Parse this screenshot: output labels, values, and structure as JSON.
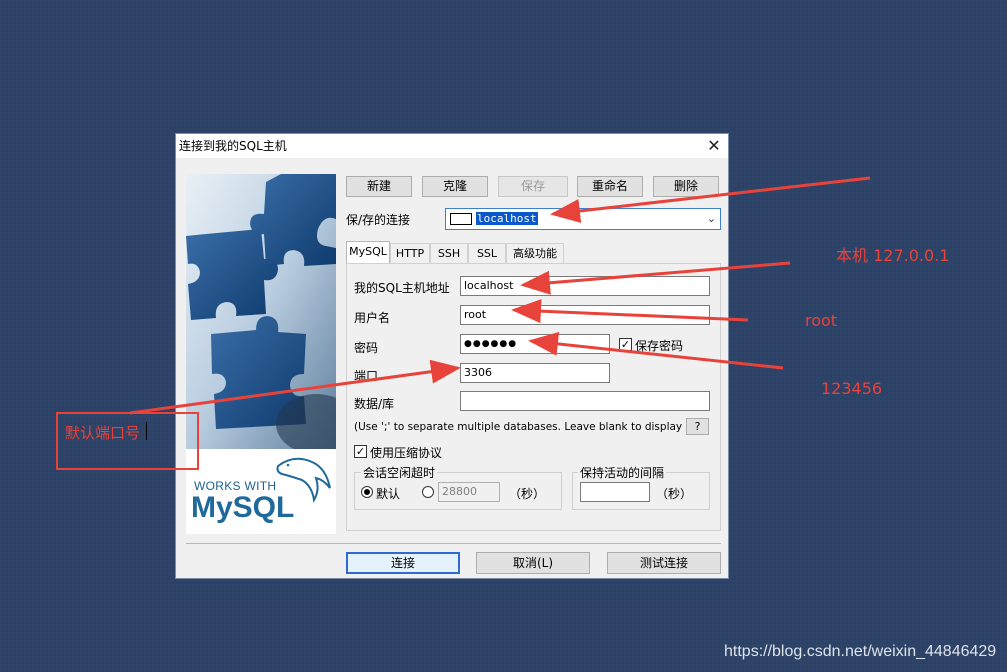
{
  "dialog": {
    "title": "连接到我的SQL主机",
    "close_glyph": "✕"
  },
  "toolbar": {
    "new": "新建",
    "clone": "克隆",
    "save": "保存",
    "rename": "重命名",
    "delete": "删除"
  },
  "saved_connections": {
    "label": "保/存的连接",
    "value": "localhost"
  },
  "tabs": [
    "MySQL",
    "HTTP",
    "SSH",
    "SSL",
    "高级功能"
  ],
  "form": {
    "host_label": "我的SQL主机地址",
    "host_value": "localhost",
    "user_label": "用户名",
    "user_value": "root",
    "password_label": "密码",
    "password_mask": "●●●●●●",
    "save_password_label": "保存密码",
    "port_label": "端口",
    "port_value": "3306",
    "db_label": "数据/库",
    "db_value": "",
    "db_hint": "(Use ';' to separate multiple databases. Leave blank to display all)",
    "help_label": "?",
    "compression_label": "使用压缩协议",
    "session_timeout_group": "会话空闲超时",
    "default_label": "默认",
    "timeout_value": "28800",
    "seconds_label": "（秒）",
    "keepalive_group": "保持活动的间隔",
    "keepalive_seconds_label": "（秒）"
  },
  "footer": {
    "connect": "连接",
    "cancel": "取消(L)",
    "test": "测试连接"
  },
  "logo": {
    "works_with": "WORKS WITH",
    "brand": "MySQL"
  },
  "annotations": {
    "host_note": "本机 127.0.0.1",
    "user_note": "root",
    "password_note": "123456",
    "port_note": "默认端口号"
  },
  "watermark": "https://blog.csdn.net/weixin_44846429",
  "colors": {
    "annotation_red": "#e8433a",
    "selection_blue": "#0a58c9",
    "default_button_border": "#2d6bd0"
  }
}
